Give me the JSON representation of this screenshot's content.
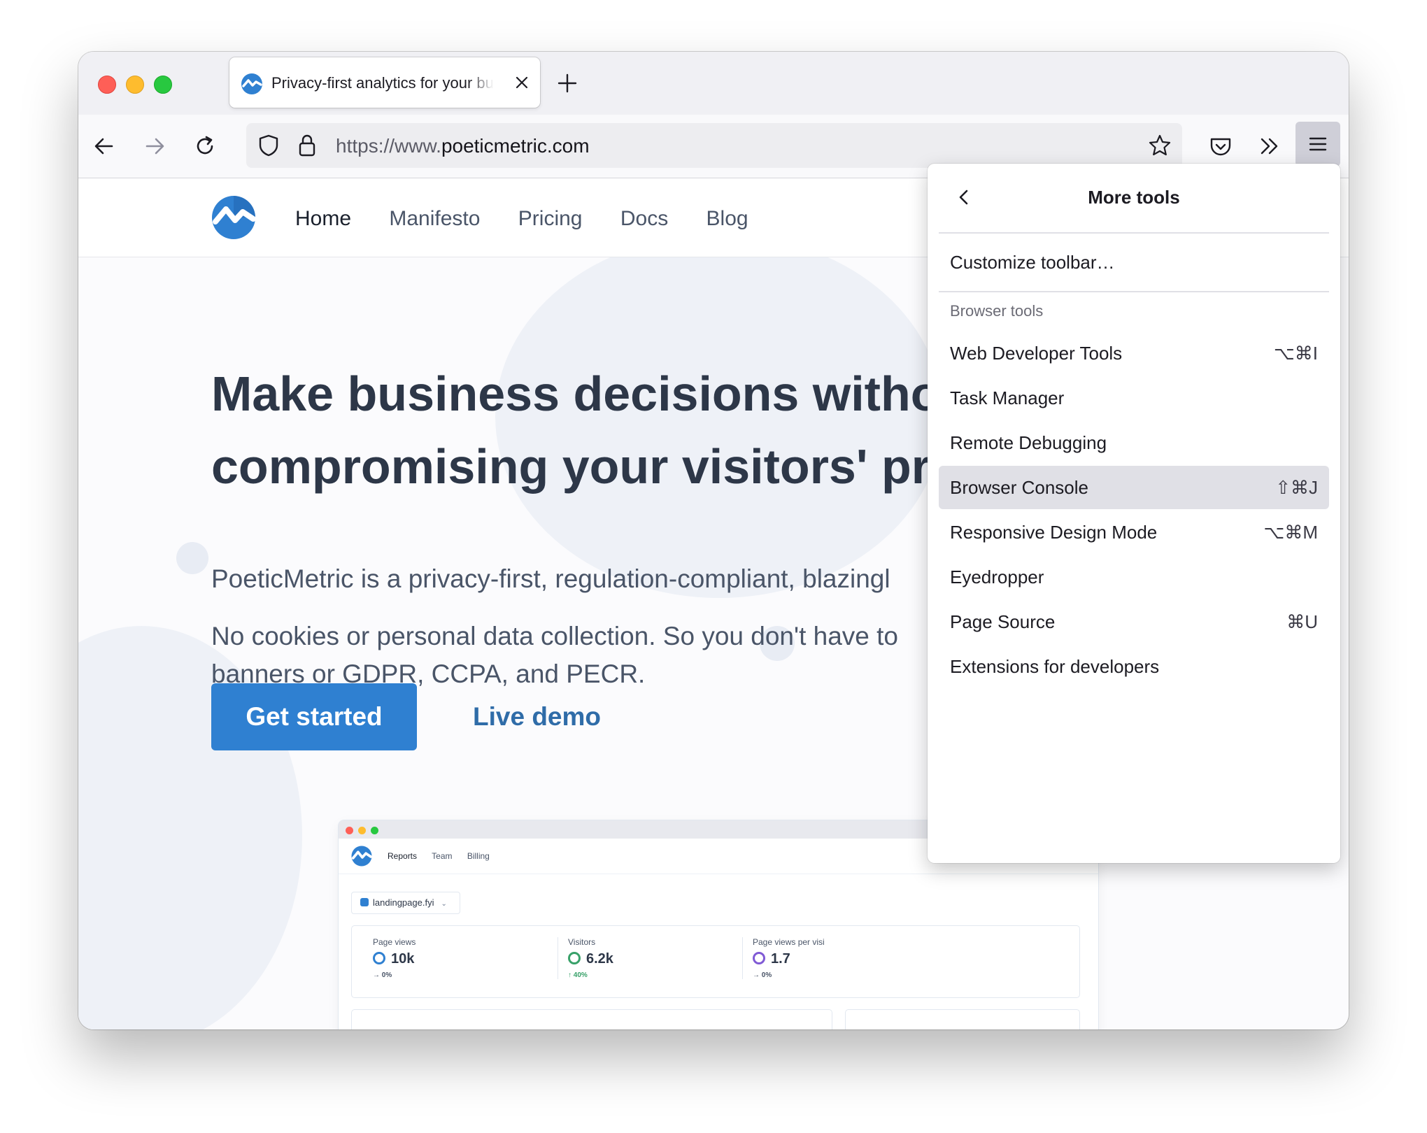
{
  "browser": {
    "tab": {
      "title": "Privacy-first analytics for your business"
    },
    "url": {
      "scheme_prefix": "https://www.",
      "host": "poeticmetric.com"
    }
  },
  "site": {
    "nav": [
      {
        "label": "Home"
      },
      {
        "label": "Manifesto"
      },
      {
        "label": "Pricing"
      },
      {
        "label": "Docs"
      },
      {
        "label": "Blog"
      }
    ],
    "hero": {
      "title_line1": "Make business decisions witho",
      "title_line2": "compromising your visitors' pr",
      "paragraph1": "PoeticMetric is a privacy-first, regulation-compliant, blazingl",
      "paragraph2_line1": "No cookies or personal data collection. So you don't have to",
      "paragraph2_line2": "banners or GDPR, CCPA, and PECR.",
      "cta_primary": "Get started",
      "cta_secondary": "Live demo"
    },
    "mockup": {
      "nav": [
        "Reports",
        "Team",
        "Billing"
      ],
      "site_select": "landingpage.fyi",
      "stats": [
        {
          "label": "Page views",
          "value": "10k",
          "change": "→ 0%"
        },
        {
          "label": "Visitors",
          "value": "6.2k",
          "change": "↑ 40%"
        },
        {
          "label": "Page views per visi",
          "value": "1.7",
          "change": "→ 0%"
        }
      ]
    }
  },
  "menu": {
    "title": "More tools",
    "customize": "Customize toolbar…",
    "section_label": "Browser tools",
    "items": [
      {
        "label": "Web Developer Tools",
        "shortcut": "⌥⌘I"
      },
      {
        "label": "Task Manager",
        "shortcut": ""
      },
      {
        "label": "Remote Debugging",
        "shortcut": ""
      },
      {
        "label": "Browser Console",
        "shortcut": "⇧⌘J"
      },
      {
        "label": "Responsive Design Mode",
        "shortcut": "⌥⌘M"
      },
      {
        "label": "Eyedropper",
        "shortcut": ""
      },
      {
        "label": "Page Source",
        "shortcut": "⌘U"
      },
      {
        "label": "Extensions for developers",
        "shortcut": ""
      }
    ],
    "highlighted_index": 3
  },
  "colors": {
    "brand_blue": "#2f80d1",
    "traffic_red": "#fe5f57",
    "traffic_yellow": "#febc2e",
    "traffic_green": "#28c840"
  }
}
